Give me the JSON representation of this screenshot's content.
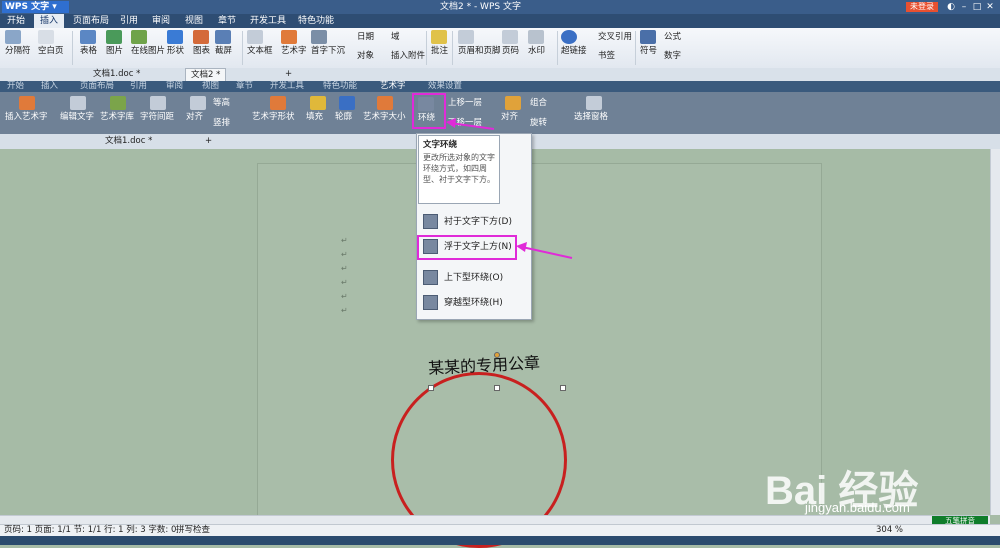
{
  "app": {
    "brand": "WPS 文字",
    "window_title": "文档2 * - WPS 文字",
    "login_label": "未登录"
  },
  "menu": [
    "开始",
    "插入",
    "页面布局",
    "引用",
    "审阅",
    "视图",
    "章节",
    "开发工具",
    "特色功能"
  ],
  "ribbon": [
    "分隔符",
    "空白页",
    "表格",
    "图片",
    "在线图片",
    "形状",
    "图表",
    "截屏",
    "文本框",
    "艺术字",
    "首字下沉",
    "日期",
    "对象",
    "域",
    "插入附件",
    "批注",
    "页眉和页脚",
    "页码",
    "水印",
    "超链接",
    "交叉引用",
    "书签",
    "符号",
    "公式",
    "数字"
  ],
  "doc_tabs": [
    "文档1.doc *",
    "文档2 *"
  ],
  "context_tabs": [
    "开始",
    "插入",
    "页面布局",
    "引用",
    "审阅",
    "视图",
    "章节",
    "开发工具",
    "特色功能",
    "艺术字",
    "效果设置"
  ],
  "art_ribbon": {
    "insert_art": "插入艺术字",
    "edit_text": "编辑文字",
    "art_lib": "艺术字库",
    "char_spacing": "字符间距",
    "align": "对齐",
    "equal_height": "等高",
    "vertical": "竖排",
    "art_shape": "艺术字形状",
    "fill": "填充",
    "outline": "轮廓",
    "art_size": "艺术字大小",
    "wrap": "环绕",
    "bring_forward": "上移一层",
    "send_backward": "下移一层",
    "align2": "对齐",
    "group": "组合",
    "rotate": "旋转",
    "selection_pane": "选择窗格"
  },
  "second_tab": "文档1.doc *",
  "tooltip": {
    "title": "文字环绕",
    "desc": "更改所选对象的文字环绕方式，如四周型、衬于文字下方。"
  },
  "wrap_menu": [
    "衬于文字下方(D)",
    "浮于文字上方(N)",
    "上下型环绕(O)",
    "穿越型环绕(H)"
  ],
  "seal_text": "某某的专用公章",
  "status": {
    "info": "页码: 1  页面: 1/1  节: 1/1  行: 1  列: 3  字数: 0",
    "spell": "拼写检查",
    "zoom": "304 %",
    "ime": "五笔拼音"
  },
  "watermark": {
    "brand": "Bai 经验",
    "url": "jingyan.baidu.com"
  },
  "colors": {
    "highlight": "#e02ad8",
    "seal": "#c8201f",
    "title_bar": "#3a5d8a"
  }
}
